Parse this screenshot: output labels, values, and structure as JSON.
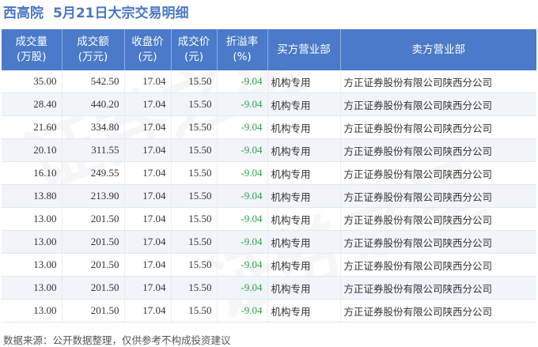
{
  "title": {
    "stock_name": "西高院",
    "subtitle": "5月21日大宗交易明细"
  },
  "table": {
    "headers": [
      [
        "成交量",
        "(万股)"
      ],
      [
        "成交额",
        "(万元)"
      ],
      [
        "收盘价",
        "(元)"
      ],
      [
        "成交价",
        "(元)"
      ],
      [
        "折溢率",
        "(%)"
      ],
      [
        "买方营业部"
      ],
      [
        "卖方营业部"
      ]
    ],
    "rows": [
      [
        "35.00",
        "542.50",
        "17.04",
        "15.50",
        "-9.04",
        "机构专用",
        "方正证券股份有限公司陕西分公司"
      ],
      [
        "28.40",
        "440.20",
        "17.04",
        "15.50",
        "-9.04",
        "机构专用",
        "方正证券股份有限公司陕西分公司"
      ],
      [
        "21.60",
        "334.80",
        "17.04",
        "15.50",
        "-9.04",
        "机构专用",
        "方正证券股份有限公司陕西分公司"
      ],
      [
        "20.10",
        "311.55",
        "17.04",
        "15.50",
        "-9.04",
        "机构专用",
        "方正证券股份有限公司陕西分公司"
      ],
      [
        "16.10",
        "249.55",
        "17.04",
        "15.50",
        "-9.04",
        "机构专用",
        "方正证券股份有限公司陕西分公司"
      ],
      [
        "13.80",
        "213.90",
        "17.04",
        "15.50",
        "-9.04",
        "机构专用",
        "方正证券股份有限公司陕西分公司"
      ],
      [
        "13.00",
        "201.50",
        "17.04",
        "15.50",
        "-9.04",
        "机构专用",
        "方正证券股份有限公司陕西分公司"
      ],
      [
        "13.00",
        "201.50",
        "17.04",
        "15.50",
        "-9.04",
        "机构专用",
        "方正证券股份有限公司陕西分公司"
      ],
      [
        "13.00",
        "201.50",
        "17.04",
        "15.50",
        "-9.04",
        "机构专用",
        "方正证券股份有限公司陕西分公司"
      ],
      [
        "13.00",
        "201.50",
        "17.04",
        "15.50",
        "-9.04",
        "机构专用",
        "方正证券股份有限公司陕西分公司"
      ],
      [
        "13.00",
        "201.50",
        "17.04",
        "15.50",
        "-9.04",
        "机构专用",
        "方正证券股份有限公司陕西分公司"
      ]
    ]
  },
  "footer": {
    "source_text": "数据来源：公开数据整理，仅供参考不构成投资建议"
  },
  "watermark": "证券之星",
  "colors": {
    "title": "#4a77c4",
    "header_bg": "#4a7ac9",
    "negative": "#2e9e49"
  }
}
